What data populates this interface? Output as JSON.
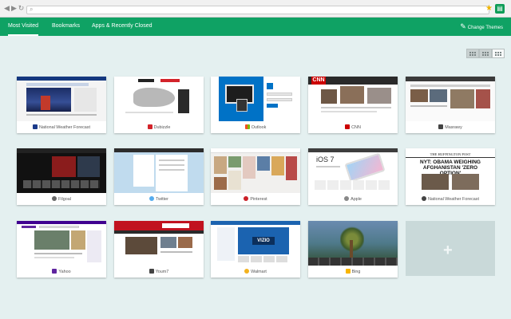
{
  "browser": {
    "url": "",
    "back_icon": "back-arrow-icon",
    "forward_icon": "forward-arrow-icon",
    "reload_icon": "reload-icon"
  },
  "nav": {
    "tabs": [
      {
        "label": "Most Visited"
      },
      {
        "label": "Bookmarks"
      },
      {
        "label": "Apps & Recently Closed"
      }
    ],
    "change_themes": "Change Themes"
  },
  "tiles": [
    {
      "title": "National Weather Forecast",
      "color": "#1a3a8a"
    },
    {
      "title": "Dubizzle",
      "color": "#d3232a"
    },
    {
      "title": "Outlook",
      "color": "#0072c6"
    },
    {
      "title": "CNN",
      "color": "#cc0000"
    },
    {
      "title": "Masrawy",
      "color": "#444444"
    },
    {
      "title": "Filgoal",
      "color": "#666666"
    },
    {
      "title": "Twitter",
      "color": "#55acee"
    },
    {
      "title": "Pinterest",
      "color": "#cb2027"
    },
    {
      "title": "Apple",
      "color": "#888888"
    },
    {
      "title": "National Weather Forecast",
      "color": "#444444"
    },
    {
      "title": "Yahoo",
      "color": "#5f259f"
    },
    {
      "title": "Youm7",
      "color": "#444444"
    },
    {
      "title": "Walmart",
      "color": "#f3b21e"
    },
    {
      "title": "Bing",
      "color": "#f8b500"
    }
  ],
  "thumb_text": {
    "huffington_masthead": "THE HUFFINGTON POST",
    "huffington_headline": "NYT: OBAMA WEIGHING AFGHANISTAN 'ZERO OPTION'",
    "apple_headline": "iOS 7",
    "cnn_logo": "CNN",
    "walmart_banner": "VIZIO"
  }
}
